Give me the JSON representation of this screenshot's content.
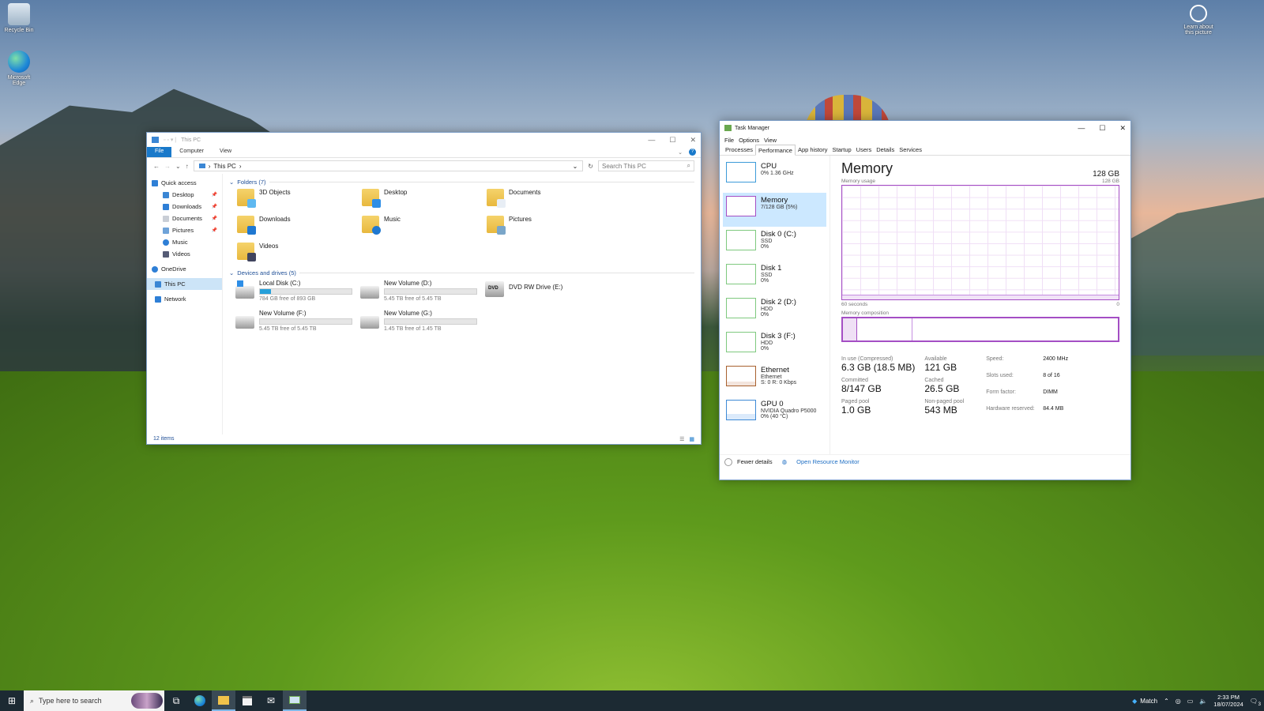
{
  "desktop": {
    "icons": [
      {
        "label": "Recycle Bin",
        "icon": "recycle-bin-icon"
      },
      {
        "label": "Microsoft Edge",
        "icon": "edge-icon"
      }
    ],
    "learn_label": "Learn about this picture"
  },
  "explorer": {
    "title": "This PC",
    "ribbon_tabs": [
      "File",
      "Computer",
      "View"
    ],
    "breadcrumb": "This PC",
    "search_placeholder": "Search This PC",
    "nav": {
      "quick_access": "Quick access",
      "items": [
        "Desktop",
        "Downloads",
        "Documents",
        "Pictures",
        "Music",
        "Videos"
      ],
      "onedrive": "OneDrive",
      "this_pc": "This PC",
      "network": "Network"
    },
    "folders_header": "Folders (7)",
    "folders": [
      "3D Objects",
      "Desktop",
      "Documents",
      "Downloads",
      "Music",
      "Pictures",
      "Videos"
    ],
    "drives_header": "Devices and drives (5)",
    "drives": [
      {
        "name": "Local Disk (C:)",
        "free": "784 GB free of 893 GB",
        "used_fraction": 0.12
      },
      {
        "name": "New Volume (D:)",
        "free": "5.45 TB free of 5.45 TB",
        "used_fraction": 0.0
      },
      {
        "name": "DVD RW Drive (E:)",
        "free": "",
        "used_fraction": null
      },
      {
        "name": "New Volume (F:)",
        "free": "5.45 TB free of 5.45 TB",
        "used_fraction": 0.0
      },
      {
        "name": "New Volume (G:)",
        "free": "1.45 TB free of 1.45 TB",
        "used_fraction": 0.0
      }
    ],
    "status": "12 items"
  },
  "taskmanager": {
    "title": "Task Manager",
    "menu": [
      "File",
      "Options",
      "View"
    ],
    "tabs": [
      "Processes",
      "Performance",
      "App history",
      "Startup",
      "Users",
      "Details",
      "Services"
    ],
    "sidebar": [
      {
        "name": "CPU",
        "l2": "0% 1.36 GHz",
        "l3": ""
      },
      {
        "name": "Memory",
        "l2": "7/128 GB (5%)",
        "l3": ""
      },
      {
        "name": "Disk 0 (C:)",
        "l2": "SSD",
        "l3": "0%"
      },
      {
        "name": "Disk 1",
        "l2": "SSD",
        "l3": "0%"
      },
      {
        "name": "Disk 2 (D:)",
        "l2": "HDD",
        "l3": "0%"
      },
      {
        "name": "Disk 3 (F:)",
        "l2": "HDD",
        "l3": "0%"
      },
      {
        "name": "Ethernet",
        "l2": "Ethernet",
        "l3": "S: 0 R: 0 Kbps"
      },
      {
        "name": "GPU 0",
        "l2": "NVIDIA Quadro P5000",
        "l3": "0% (40 °C)"
      }
    ],
    "memory": {
      "title": "Memory",
      "total": "128 GB",
      "usage_label": "Memory usage",
      "usage_max": "128 GB",
      "time_label": "60 seconds",
      "time_end": "0",
      "composition_label": "Memory composition",
      "in_use_label": "In use (Compressed)",
      "in_use": "6.3 GB (18.5 MB)",
      "available_label": "Available",
      "available": "121 GB",
      "committed_label": "Committed",
      "committed": "8/147 GB",
      "cached_label": "Cached",
      "cached": "26.5 GB",
      "paged_label": "Paged pool",
      "paged": "1.0 GB",
      "nonpaged_label": "Non-paged pool",
      "nonpaged": "543 MB",
      "speed_label": "Speed:",
      "speed": "2400 MHz",
      "slots_label": "Slots used:",
      "slots": "8 of 16",
      "form_label": "Form factor:",
      "form": "DIMM",
      "reserved_label": "Hardware reserved:",
      "reserved": "84.4 MB"
    },
    "fewer_details": "Fewer details",
    "open_resource_monitor": "Open Resource Monitor"
  },
  "taskbar": {
    "search_placeholder": "Type here to search",
    "weather": "Match",
    "time": "2:33 PM",
    "date": "18/07/2024",
    "notifications": "3"
  }
}
